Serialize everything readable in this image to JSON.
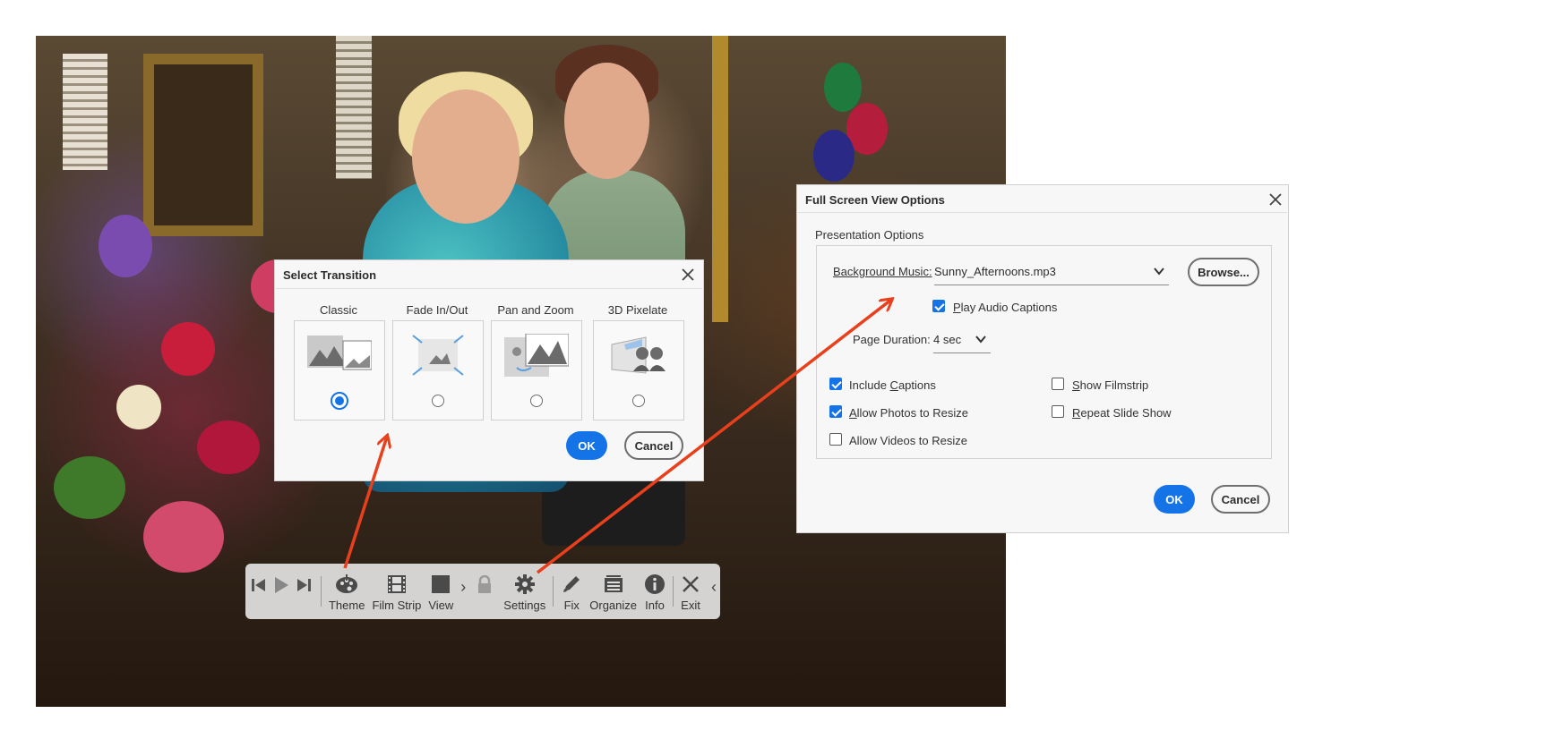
{
  "toolbar": {
    "theme": "Theme",
    "film_strip": "Film Strip",
    "view": "View",
    "settings": "Settings",
    "fix": "Fix",
    "organize": "Organize",
    "info": "Info",
    "exit": "Exit"
  },
  "select_transition": {
    "title": "Select Transition",
    "options": [
      {
        "label": "Classic",
        "selected": true
      },
      {
        "label": "Fade In/Out",
        "selected": false
      },
      {
        "label": "Pan and Zoom",
        "selected": false
      },
      {
        "label": "3D Pixelate",
        "selected": false
      }
    ],
    "ok": "OK",
    "cancel": "Cancel"
  },
  "full_screen_options": {
    "title": "Full Screen View Options",
    "group_label": "Presentation Options",
    "background_music_label": "Background Music:",
    "background_music_value": "Sunny_Afternoons.mp3",
    "browse": "Browse...",
    "play_audio_captions": {
      "label": "Play Audio Captions",
      "checked": true
    },
    "page_duration_label": "Page Duration:",
    "page_duration_value": "4 sec",
    "include_captions": {
      "label": "Include Captions",
      "checked": true
    },
    "allow_photos_resize": {
      "label": "Allow Photos to Resize",
      "checked": true
    },
    "allow_videos_resize": {
      "label": "Allow Videos to Resize",
      "checked": false
    },
    "show_filmstrip": {
      "label": "Show Filmstrip",
      "checked": false
    },
    "repeat_slide_show": {
      "label": "Repeat Slide Show",
      "checked": false
    },
    "ok": "OK",
    "cancel": "Cancel"
  },
  "colors": {
    "accent": "#1473e6",
    "annotation_arrow": "#e8401c"
  }
}
